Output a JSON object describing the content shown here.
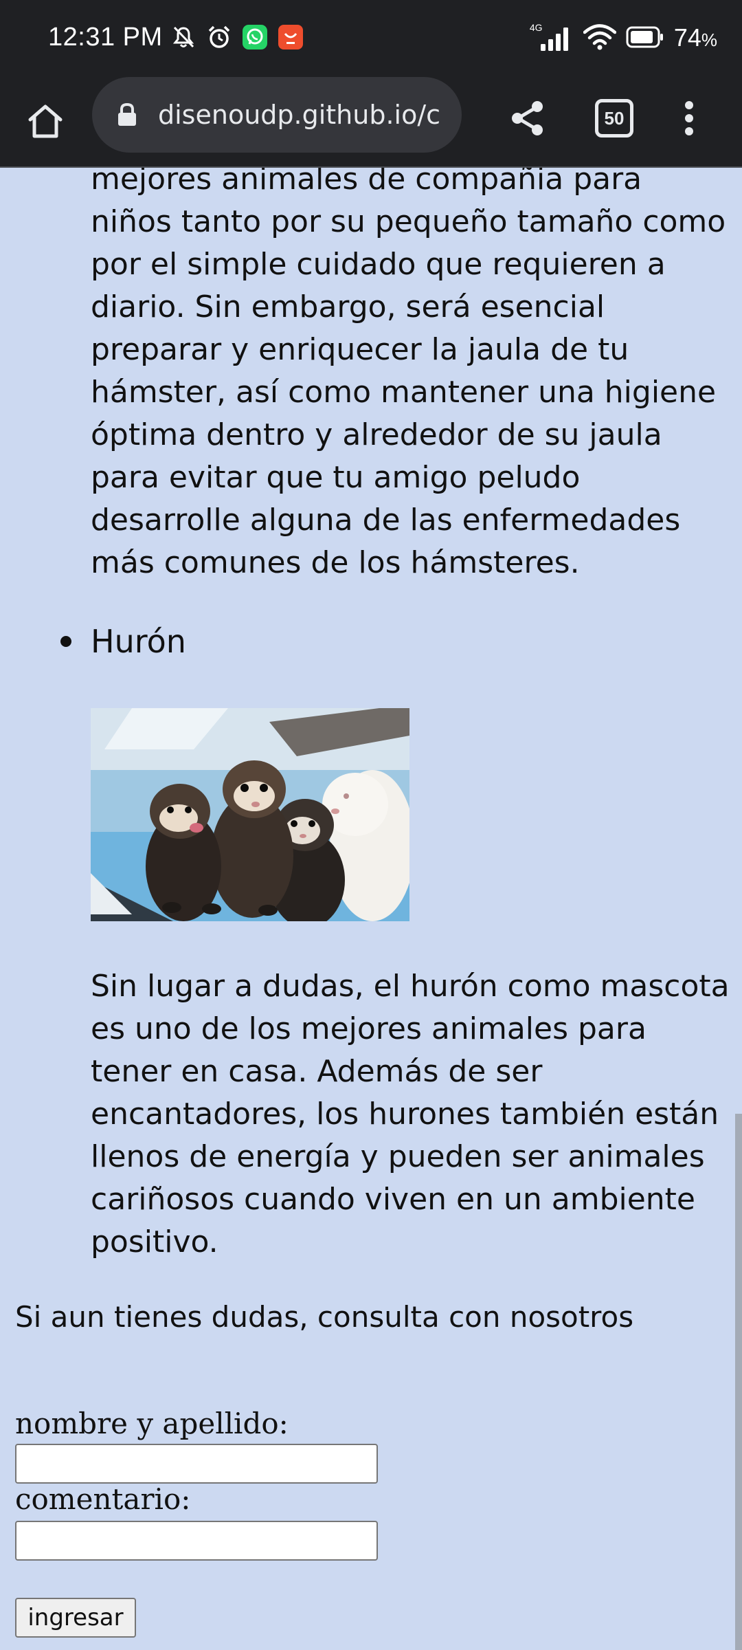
{
  "status_bar": {
    "time": "12:31 PM",
    "network_label": "4G",
    "battery_percent": "74",
    "battery_suffix": "%",
    "left_icons": [
      "mute-icon",
      "alarm-icon",
      "whatsapp-icon",
      "notification-app-icon"
    ],
    "right_icons": [
      "cellular-signal-icon",
      "wifi-icon",
      "battery-icon"
    ]
  },
  "browser": {
    "url": "disenoudp.github.io/c",
    "tab_count": "50",
    "icons": [
      "home-icon",
      "lock-icon",
      "share-icon",
      "tabs-icon",
      "more-vert-icon"
    ]
  },
  "content": {
    "hamster_paragraph": "mejores animales de compañia para niños tanto por su pequeño tamaño como por el simple cuidado que requieren a diario. Sin embargo, será esencial preparar y enriquecer la jaula de tu hámster, así como mantener una higiene óptima dentro y alrededor de su jaula para evitar que tu amigo peludo desarrolle alguna de las enfermedades más comunes de los hámsteres.",
    "list_item_title": "Hurón",
    "huron_paragraph": "Sin lugar a dudas, el hurón como mascota es uno de los mejores animales para tener en casa. Además de ser encantadores, los hurones también están llenos de energía y pueden ser animales cariñosos cuando viven en un ambiente positivo.",
    "consult_text": "Si aun tienes dudas, consulta con nosotros"
  },
  "form": {
    "name_label": "nombre y apellido:",
    "name_value": "",
    "comment_label": "comentario:",
    "comment_value": "",
    "submit_label": "ingresar"
  },
  "colors": {
    "page_background": "#ccd9f1",
    "chrome_background": "#1f2023",
    "omnibox_background": "#35363b",
    "whatsapp_green": "#25d366",
    "app_badge_red": "#ee4d2d"
  }
}
